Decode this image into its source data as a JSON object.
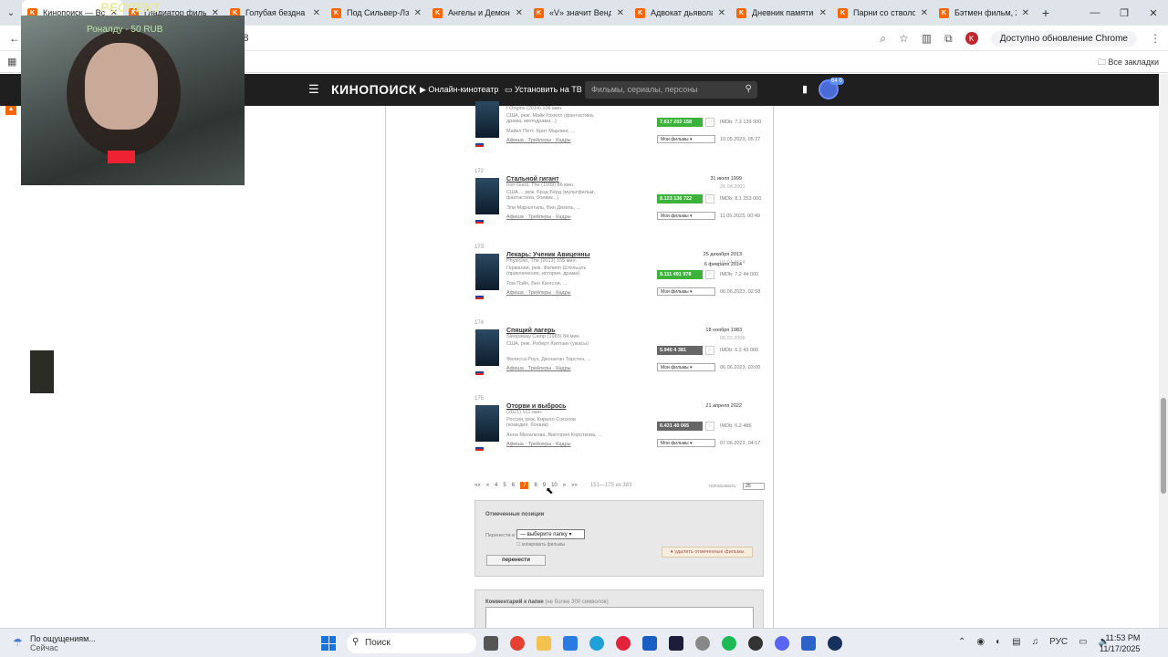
{
  "browser": {
    "tabs": [
      {
        "label": "Кинопоиск — Все",
        "active": true
      },
      {
        "label": "Гладиатор фильм,"
      },
      {
        "label": "Голубая бездна"
      },
      {
        "label": "Под Сильвер-Лэй"
      },
      {
        "label": "Ангелы и Демон"
      },
      {
        "label": "«V» значит Венд"
      },
      {
        "label": "Адвокат дьявола"
      },
      {
        "label": "Дневник памяти"
      },
      {
        "label": "Парни со стволо"
      },
      {
        "label": "Бэтмен фильм, 2"
      }
    ],
    "url_fragment": "=8",
    "update_label": "Доступно обновление Chrome",
    "profile_letter": "K",
    "bookmarks_label": "Все закладки"
  },
  "stream": {
    "title": "РЕСПЕКТ",
    "donation": "Роналду - 50 RUB"
  },
  "header": {
    "logo": "КИНОПОИСК",
    "online_label": "Онлайн-кинотеатр",
    "tv_label": "Установить на ТВ",
    "search_placeholder": "Фильмы, сериалы, персоны",
    "user_badge": "64 б"
  },
  "films": [
    {
      "num": "",
      "title": "",
      "orig": "I Origins (2014) 106 мин.",
      "crew": "США, реж. Майк Кэхилл (фантастика, драма, мелодрама...)",
      "actors": "Майкл Питт, Брит Марлинг, ...",
      "links": "Афиша · Трейлеры · Кадры",
      "date": "",
      "date2": "",
      "rating": "7.617  202 158",
      "grey": false,
      "imdb": "IMDb: 7.3  139 000",
      "added": "10.05.2023, 05:27",
      "rdate": "",
      "folder": "Мои фильмы"
    },
    {
      "num": "172",
      "title": "Стальной гигант",
      "orig": "Iron Giant, The (1999) 86 мин.",
      "crew": "США..., реж. Брэд Бёрд (мультфильм, фантастика, боевик...)",
      "actors": "Эли Марієнталь, Вин Дизель, ...",
      "links": "Афиша · Трейлеры · Кадры",
      "date": "31 июля 1999",
      "date2": "",
      "rating": "8.123  136 722",
      "grey": false,
      "imdb": "IMDb: 8.1  253 000",
      "added": "11.05.2023, 00:49",
      "rdate": "26.04.2001",
      "folder": "Мои фильмы"
    },
    {
      "num": "173",
      "title": "Лекарь: Ученик Авиценны",
      "orig": "Physician, The (2013) 155 мин.",
      "crew": "Германия, реж. Филипп Штёльцль (приключения, история, драма)",
      "actors": "Том Пэйн, Бен Кингсли, ...",
      "links": "Афиша · Трейлеры · Кадры",
      "date": "25 декабря 2013",
      "date2": "6 февраля 2014",
      "rating": "8.111  491 978",
      "grey": false,
      "imdb": "IMDb: 7.2  44 000",
      "added": "06.06.2023, 02:58",
      "rdate": "01.04.2014",
      "folder": "Мои фильмы"
    },
    {
      "num": "174",
      "title": "Спящий лагерь",
      "orig": "Sleepaway Camp (1983) 84 мин.",
      "crew": "США, реж. Роберт Хилтзик (ужасы)",
      "actors": "Фелисса Роуз, Джонатан Тирстен, ...",
      "links": "Афиша · Трейлеры · Кадры",
      "date": "18 ноября 1983",
      "date2": "",
      "rating": "5.940  4 381",
      "grey": true,
      "imdb": "IMDb: 6.2  43 000",
      "added": "06.06.2023, 03:00",
      "rdate": "05.03.2009",
      "folder": "Мои фильмы"
    },
    {
      "num": "175",
      "title": "Оторви и выбрось",
      "orig": "(2021) 101 мин.",
      "crew": "Россия, реж. Кирилл Соколов (комедия, боевик)",
      "actors": "Анна Михалкова, Виктория Короткова, ...",
      "links": "Афиша · Трейлеры · Кадры",
      "date": "21 апреля 2022",
      "date2": "",
      "rating": "6.431  40 065",
      "grey": true,
      "imdb": "IMDb: 6.2  486",
      "added": "07.06.2023, 04:17",
      "rdate": "",
      "folder": "Мои фильмы"
    }
  ],
  "pager": {
    "items": [
      "««",
      "«",
      "4",
      "5",
      "6",
      "7",
      "8",
      "9",
      "10",
      "»",
      "»»"
    ],
    "current": "7",
    "range": "151—175 из 383",
    "perpage_label": "показывать:",
    "perpage_value": "25"
  },
  "marked": {
    "title": "Отмеченные позиции",
    "move_label": "Перенести в",
    "folder_select": "— выберите папку",
    "copy_label": "копировать фильмы",
    "move_button": "перенести",
    "delete_button": "удалить отмеченные фильмы"
  },
  "comment": {
    "title": "Комментарий к папке",
    "hint": "(не более 300 символов)"
  },
  "taskbar": {
    "weather_title": "По ощущениям...",
    "weather_sub": "Сейчас",
    "search": "Поиск",
    "lang": "РУС",
    "time": "11:53 PM",
    "date": "11/17/2025"
  }
}
